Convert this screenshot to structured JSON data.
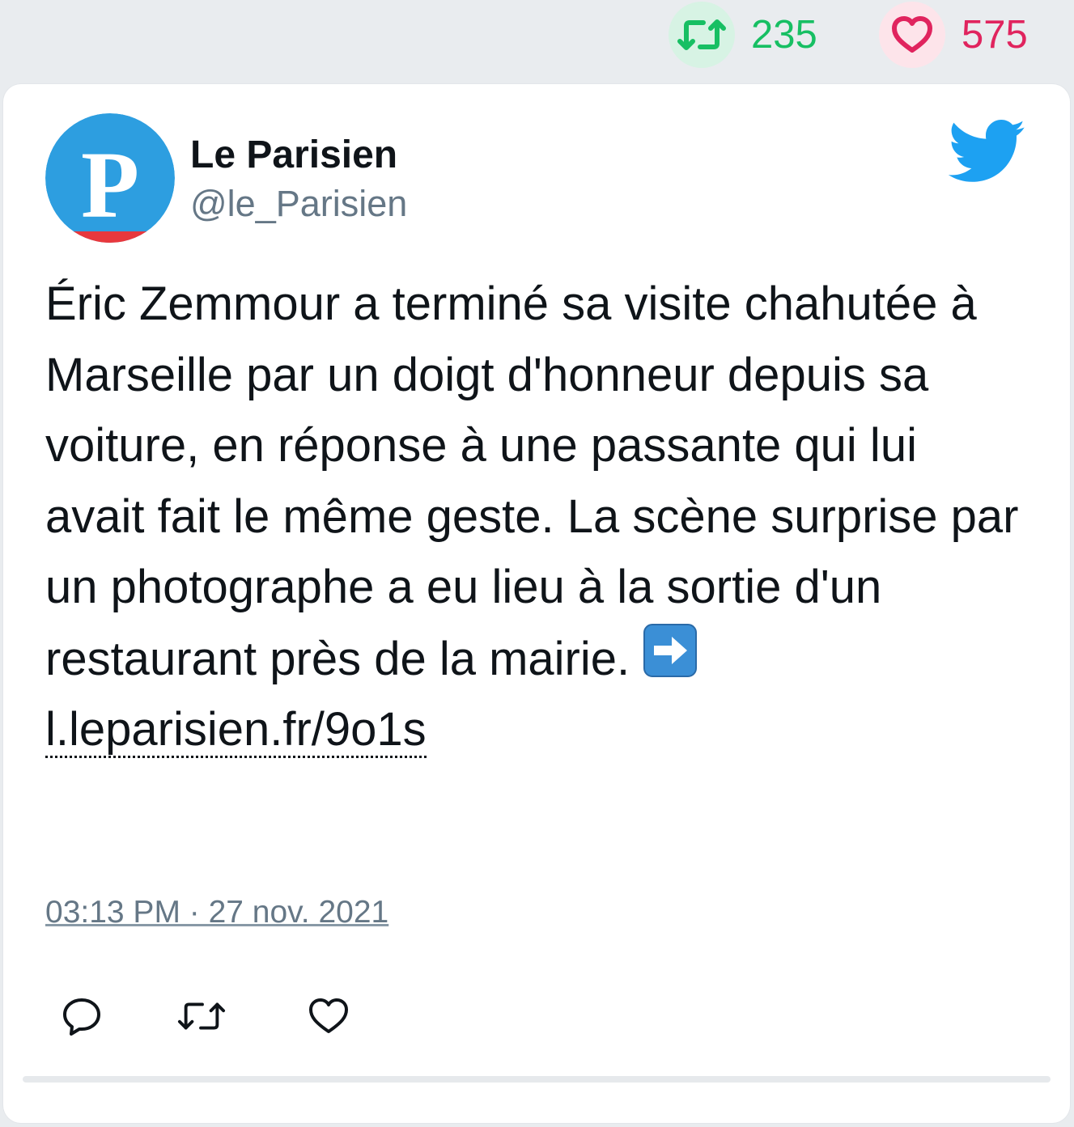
{
  "stats": {
    "retweet_count": "235",
    "like_count": "575",
    "retweet_color": "#17bf63",
    "like_color": "#e0245e"
  },
  "tweet": {
    "author_name": "Le Parisien",
    "author_handle": "@le_Parisien",
    "avatar_letter": "P",
    "text": "Éric Zemmour a terminé sa visite chahutée à Marseille par un doigt d'honneur depuis sa voiture, en réponse à une passante qui lui avait fait le même geste. La scène surprise par un photographe a eu lieu à la sortie d'un restaurant près de la mairie.",
    "link": "l.leparisien.fr/9o1s",
    "timestamp": "03:13 PM · 27 nov. 2021"
  },
  "icons": {
    "brand": "twitter-bird-icon",
    "emoji": "right-arrow-emoji",
    "actions": [
      "reply-icon",
      "retweet-icon",
      "like-icon"
    ]
  },
  "colors": {
    "twitter_blue": "#1da1f2",
    "avatar_blue": "#2d9ee0",
    "avatar_red": "#e8383d",
    "secondary_text": "#657786"
  }
}
